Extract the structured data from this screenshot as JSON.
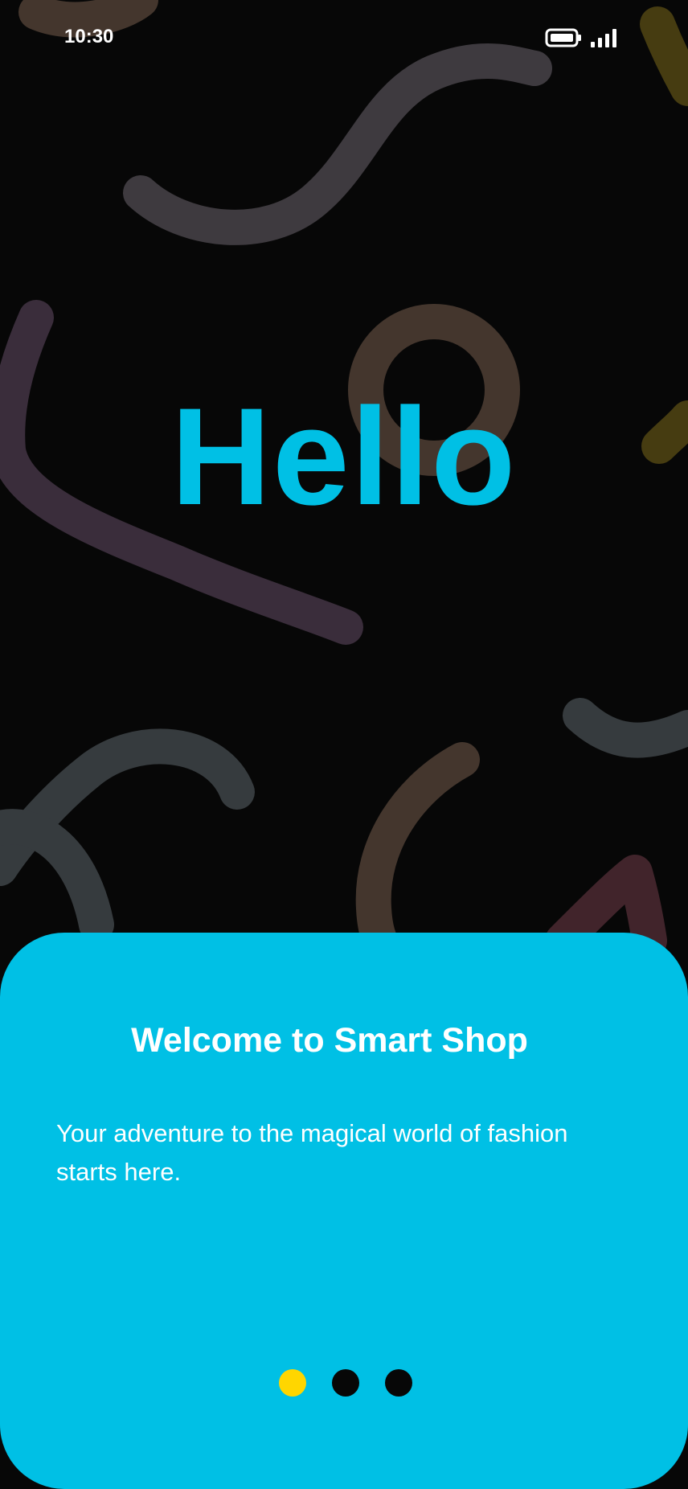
{
  "status_bar": {
    "time": "10:30",
    "battery_icon": "battery-full-icon",
    "signal_icon": "cellular-signal-icon"
  },
  "hero": {
    "title": "Hello"
  },
  "onboarding": {
    "title": "Welcome to Smart Shop",
    "description": "Your adventure to the magical world of fashion starts here.",
    "page_count": 3,
    "active_page": 1
  },
  "colors": {
    "background": "#070707",
    "accent": "#00C0E5",
    "text_on_accent": "#FFFFFF",
    "active_dot": "#FFD600",
    "inactive_dot": "#070707",
    "doodle_purple": "#3A2D3B",
    "doodle_gray": "#3E3A3F",
    "doodle_brown": "#44362D",
    "doodle_slate": "#363B3E",
    "doodle_olive": "#463C11",
    "doodle_maroon": "#41242B"
  }
}
